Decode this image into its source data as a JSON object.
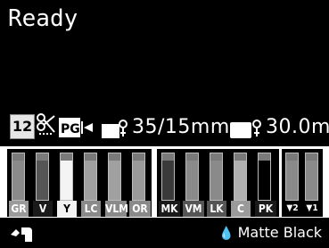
{
  "status": "Ready",
  "info": {
    "cut_number": "12",
    "pg_label": "PG",
    "thickness": "35/15mm",
    "remaining": "30.0m"
  },
  "inks": {
    "group1": [
      {
        "code": "GR",
        "level": 0.85,
        "label_bg": "#9a9a9a",
        "label_fg": "#ffffff"
      },
      {
        "code": "V",
        "level": 0.85,
        "label_bg": "#1a1a1a",
        "label_fg": "#ffffff"
      },
      {
        "code": "Y",
        "level": 0.85,
        "label_bg": "#f2f2f2",
        "label_fg": "#000000"
      },
      {
        "code": "LC",
        "level": 0.85,
        "label_bg": "#8a8a8a",
        "label_fg": "#ffffff"
      },
      {
        "code": "VLM",
        "level": 0.85,
        "label_bg": "#8a8a8a",
        "label_fg": "#ffffff"
      },
      {
        "code": "OR",
        "level": 0.85,
        "label_bg": "#8a8a8a",
        "label_fg": "#ffffff"
      }
    ],
    "group2": [
      {
        "code": "MK",
        "level": 0.85,
        "label_bg": "#1a1a1a",
        "label_fg": "#ffffff"
      },
      {
        "code": "VM",
        "level": 0.85,
        "label_bg": "#555555",
        "label_fg": "#ffffff"
      },
      {
        "code": "LK",
        "level": 0.85,
        "label_bg": "#555555",
        "label_fg": "#ffffff"
      },
      {
        "code": "C",
        "level": 0.85,
        "label_bg": "#9a9a9a",
        "label_fg": "#ffffff"
      },
      {
        "code": "PK",
        "level": 0.85,
        "label_bg": "#1a1a1a",
        "label_fg": "#ffffff"
      }
    ],
    "maintenance": [
      {
        "code": "2",
        "level": 0.85
      },
      {
        "code": "1",
        "level": 0.85
      }
    ]
  },
  "black_ink": "Matte Black",
  "icons": {
    "cut": "scissors-icon",
    "paper": "paper-roll-icon",
    "hand": "hand-icon",
    "drop": "ink-drop-icon"
  }
}
